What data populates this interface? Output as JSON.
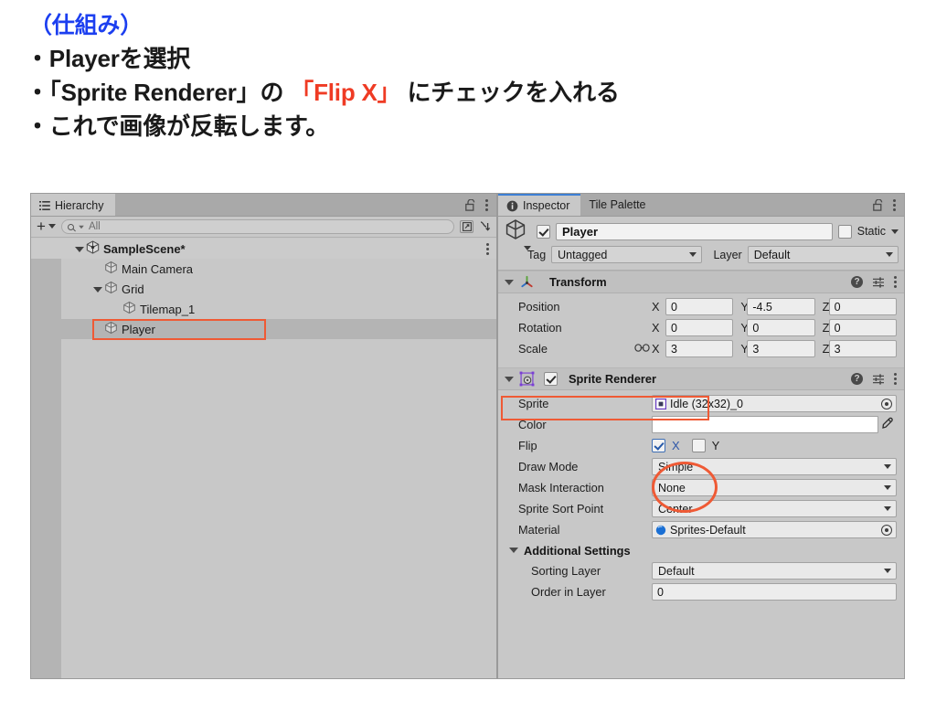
{
  "slide": {
    "heading": "（仕組み）",
    "bullets": [
      {
        "parts": [
          {
            "text": "・Playerを選択",
            "accent": false
          }
        ]
      },
      {
        "parts": [
          {
            "text": "・「Sprite Renderer」の ",
            "accent": false
          },
          {
            "text": "「Flip X」",
            "accent": true
          },
          {
            "text": " にチェックを入れる",
            "accent": false
          }
        ]
      },
      {
        "parts": [
          {
            "text": "・これで画像が反転します。",
            "accent": false
          }
        ]
      }
    ],
    "accent_color": "#ef3b24",
    "heading_color": "#1c3ff0"
  },
  "hierarchy": {
    "tab_label": "Hierarchy",
    "tab_icon": "hierarchy-list-icon",
    "lock_icon": "lock-open-icon",
    "menu_icon": "kebab-menu-icon",
    "toolbar": {
      "create_label": "+",
      "search_placeholder": "All",
      "search_value": "",
      "visibility_button": "window-picker-icon",
      "sort_button": "alphabetical-sort-icon"
    },
    "tree": [
      {
        "label": "SampleScene*",
        "depth": 0,
        "expanded": true,
        "type": "scene",
        "selected": false
      },
      {
        "label": "Main Camera",
        "depth": 2,
        "expanded": null,
        "type": "gameobject",
        "selected": false
      },
      {
        "label": "Grid",
        "depth": 1,
        "expanded": true,
        "type": "gameobject",
        "selected": false
      },
      {
        "label": "Tilemap_1",
        "depth": 2,
        "expanded": null,
        "type": "gameobject",
        "selected": false
      },
      {
        "label": "Player",
        "depth": 1,
        "expanded": null,
        "type": "gameobject",
        "selected": true
      }
    ]
  },
  "inspector": {
    "tabs": [
      {
        "label": "Inspector",
        "active": true,
        "icon": "info-icon"
      },
      {
        "label": "Tile Palette",
        "active": false,
        "icon": ""
      }
    ],
    "lock_icon": "lock-open-icon",
    "menu_icon": "kebab-menu-icon",
    "gameobject": {
      "enabled": true,
      "name": "Player",
      "static_label": "Static",
      "static_checked": false,
      "tag_label": "Tag",
      "tag_value": "Untagged",
      "layer_label": "Layer",
      "layer_value": "Default"
    },
    "transform": {
      "title": "Transform",
      "expanded": true,
      "icon": "transform-axes-icon",
      "rows": [
        {
          "label": "Position",
          "x": "0",
          "y": "-4.5",
          "z": "0",
          "link": false
        },
        {
          "label": "Rotation",
          "x": "0",
          "y": "0",
          "z": "0",
          "link": false
        },
        {
          "label": "Scale",
          "x": "3",
          "y": "3",
          "z": "3",
          "link": true
        }
      ],
      "axis_labels": {
        "x": "X",
        "y": "Y",
        "z": "Z"
      }
    },
    "sprite_renderer": {
      "title": "Sprite Renderer",
      "expanded": true,
      "enabled": true,
      "icon": "sprite-renderer-icon",
      "sprite_label": "Sprite",
      "sprite_value": "Idle (32x32)_0",
      "color_label": "Color",
      "color_value": "#FFFFFF",
      "flip_label": "Flip",
      "flip_x_label": "X",
      "flip_x_checked": true,
      "flip_y_label": "Y",
      "flip_y_checked": false,
      "draw_mode_label": "Draw Mode",
      "draw_mode_value": "Simple",
      "mask_interaction_label": "Mask Interaction",
      "mask_interaction_value": "None",
      "sprite_sort_point_label": "Sprite Sort Point",
      "sprite_sort_point_value": "Center",
      "material_label": "Material",
      "material_value": "Sprites-Default",
      "additional_settings_label": "Additional Settings",
      "sorting_layer_label": "Sorting Layer",
      "sorting_layer_value": "Default",
      "order_in_layer_label": "Order in Layer",
      "order_in_layer_value": "0"
    }
  },
  "annotations": {
    "color": "#ef5a35",
    "shapes": [
      {
        "name": "player-row-highlight",
        "type": "box"
      },
      {
        "name": "sprite-renderer-header-highlight",
        "type": "box"
      },
      {
        "name": "flip-x-checkbox-circle",
        "type": "ellipse"
      }
    ]
  }
}
